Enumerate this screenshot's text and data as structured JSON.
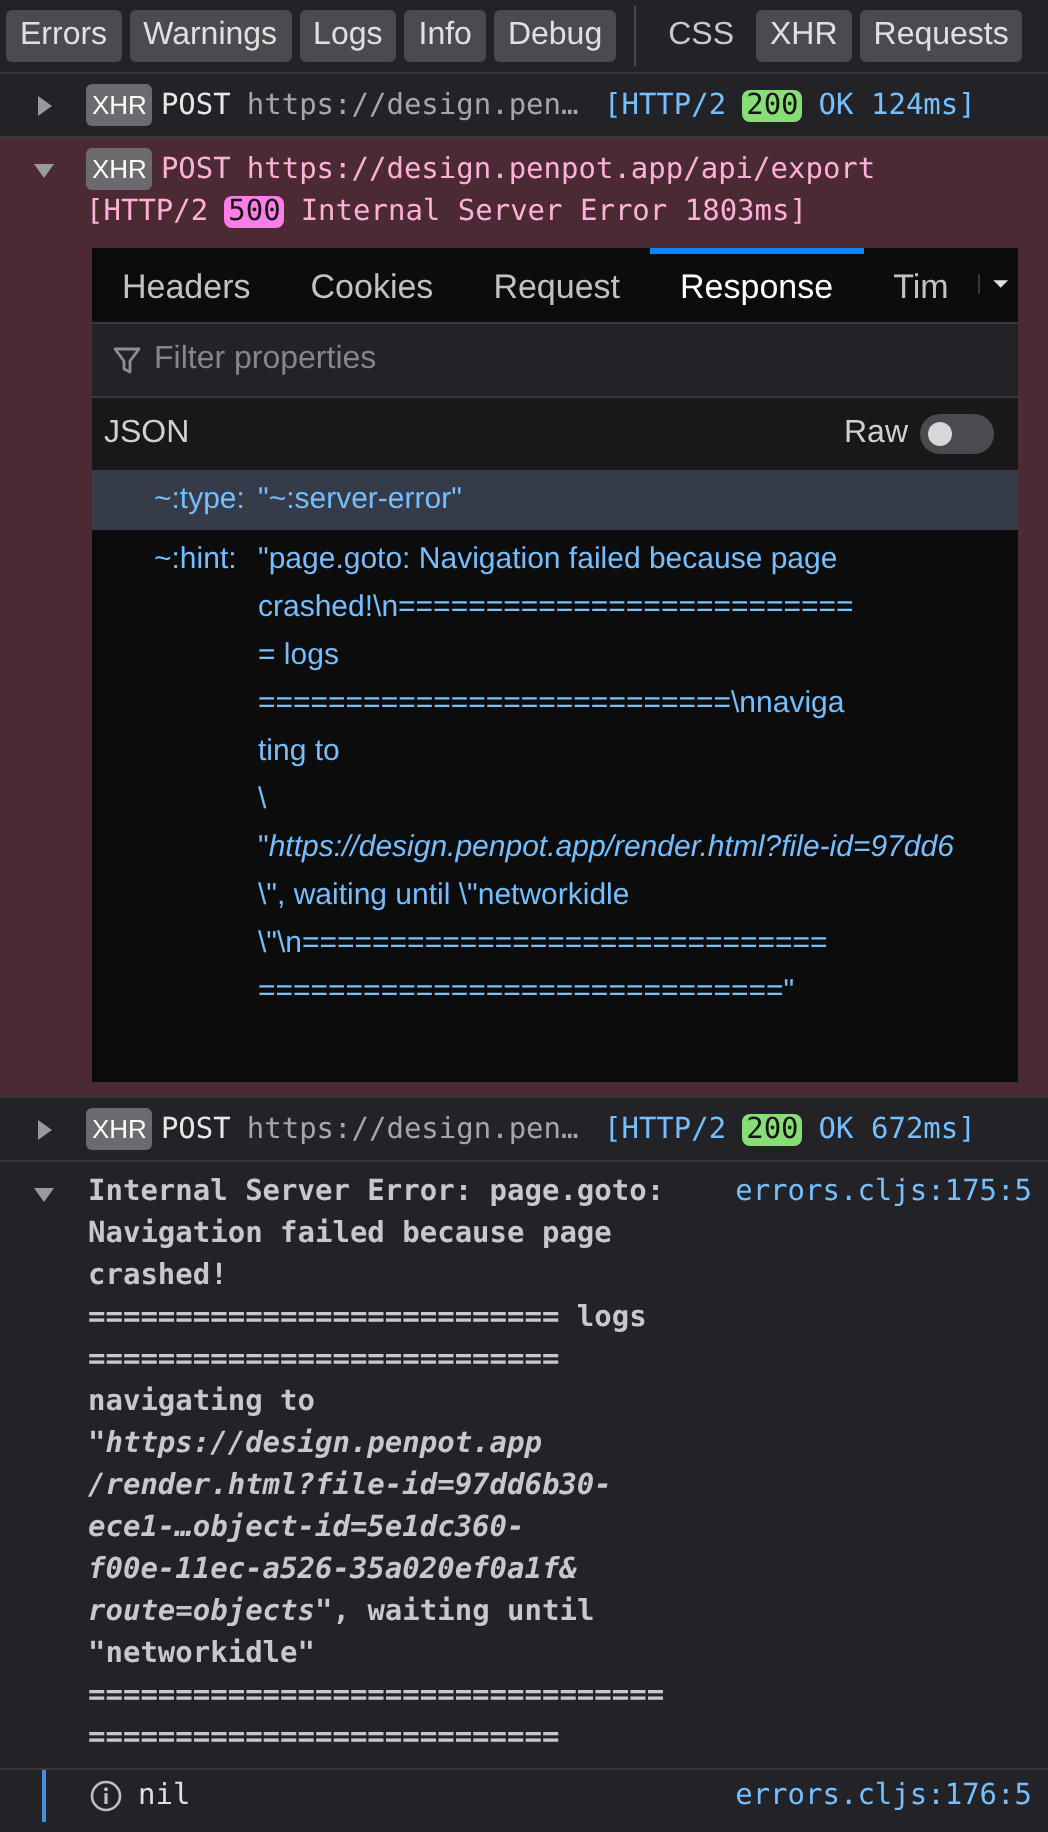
{
  "filters": [
    {
      "label": "Errors",
      "selected": true
    },
    {
      "label": "Warnings",
      "selected": true
    },
    {
      "label": "Logs",
      "selected": true
    },
    {
      "label": "Info",
      "selected": true
    },
    {
      "label": "Debug",
      "selected": true
    },
    {
      "label": "CSS",
      "selected": false,
      "group_start": true
    },
    {
      "label": "XHR",
      "selected": true
    },
    {
      "label": "Requests",
      "selected": true
    }
  ],
  "messages": [
    {
      "kind": "request",
      "expanded": false,
      "error": false,
      "badge": "XHR",
      "method": "POST",
      "url": "https://design.pen…",
      "protocol": "[HTTP/2",
      "status": "200",
      "status_text": "OK 124ms]"
    },
    {
      "kind": "request",
      "expanded": true,
      "error": true,
      "badge": "XHR",
      "method": "POST",
      "url": "https://design.penpot.app/api/export",
      "protocol": "[HTTP/2",
      "status": "500",
      "status_text": "Internal Server Error 1803ms]",
      "details": {
        "tabs": [
          {
            "label": "Headers",
            "selected": false
          },
          {
            "label": "Cookies",
            "selected": false
          },
          {
            "label": "Request",
            "selected": false
          },
          {
            "label": "Response",
            "selected": true
          },
          {
            "label": "Tim",
            "selected": false
          }
        ],
        "filter": {
          "placeholder": "Filter properties"
        },
        "format": "JSON",
        "raw": {
          "label": "Raw",
          "on": false
        },
        "properties": [
          {
            "key": "~:type:",
            "selected": true,
            "value_lines": [
              "\"~:server-error\""
            ]
          },
          {
            "key": "~:hint:",
            "selected": false,
            "value_lines": [
              "\"page.goto: Navigation failed because page",
              "crashed!\\n==========================",
              "= logs",
              "===========================\\nnaviga",
              "ting to",
              "\\",
              "\"*https://design.penpot.app/render.html?file-id=97dd6*",
              "\\\", waiting until \\\"networkidle",
              "\\\"\\n==============================",
              "==============================\""
            ]
          }
        ]
      }
    },
    {
      "kind": "request",
      "expanded": false,
      "error": false,
      "badge": "XHR",
      "method": "POST",
      "url": "https://design.pen…",
      "protocol": "[HTTP/2",
      "status": "200",
      "status_text": "OK 672ms]"
    },
    {
      "kind": "error",
      "expanded": true,
      "source": "errors.cljs:175:5",
      "lines": [
        "Internal Server Error: page.goto:",
        "Navigation failed because page",
        "crashed!",
        "=========================== logs",
        "===========================",
        "navigating to",
        "\"*https://design.penpot.app*",
        "*/render.html?file-id=97dd6b30-*",
        "*ece1-…object-id=5e1dc360-*",
        "*f00e-11ec-a526-35a020ef0a1f&*",
        "*route=objects*\", waiting until",
        "\"networkidle\"",
        "=================================",
        "==========================="
      ]
    },
    {
      "kind": "log",
      "text": "nil",
      "source": "errors.cljs:176:5"
    }
  ]
}
